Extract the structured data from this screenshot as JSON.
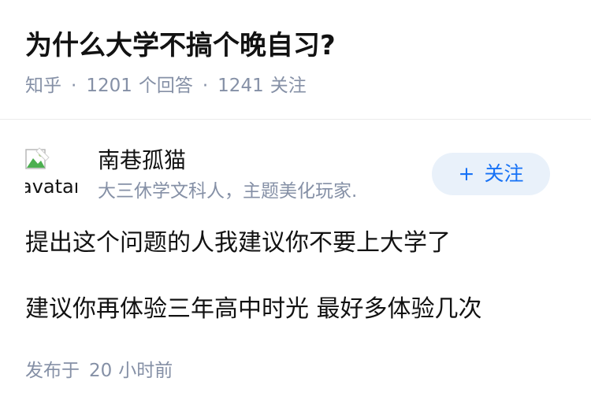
{
  "question": {
    "title": "为什么大学不搞个晚自习?",
    "source": "知乎",
    "answer_count": "1201",
    "answer_label": "个回答",
    "follower_count": "1241",
    "follower_label": "关注"
  },
  "author": {
    "avatar_alt": "avatar",
    "avatar_icon": "broken-image-icon",
    "name": "南巷孤猫",
    "bio": "大三休学文科人，主题美化玩家.",
    "follow_plus": "+",
    "follow_label": "关注",
    "follow_button_color": "#1772f6",
    "follow_button_bg": "#e9f1fa"
  },
  "answer": {
    "paragraphs": [
      "提出这个问题的人我建议你不要上大学了",
      "建议你再体验三年高中时光 最好多体验几次"
    ],
    "published_label": "发布于",
    "published_amount": "20",
    "published_unit": "小时前"
  }
}
